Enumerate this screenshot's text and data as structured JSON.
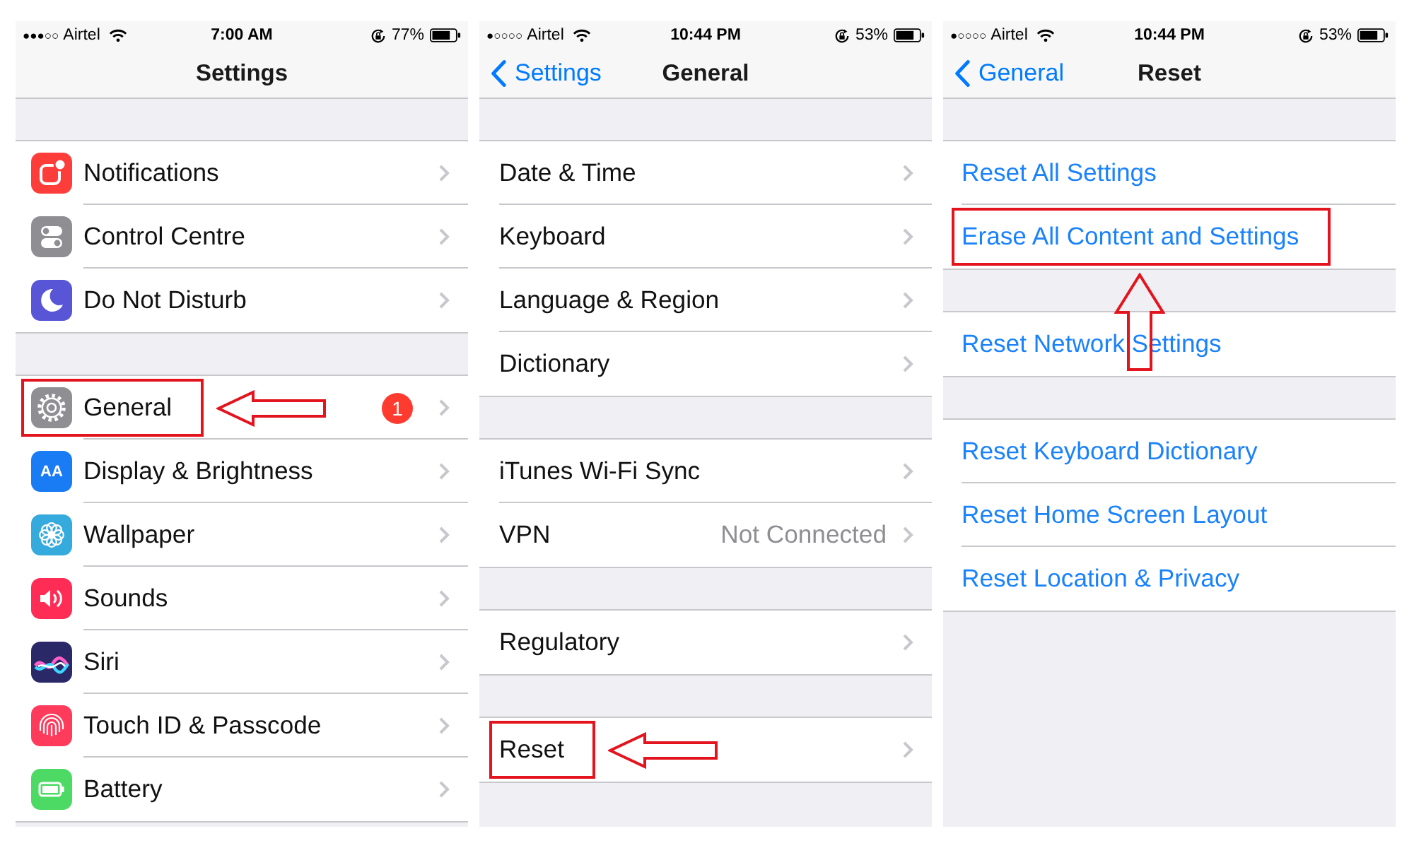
{
  "screens": [
    {
      "status_bar": {
        "signal": "●●●○○",
        "carrier": "Airtel",
        "time": "7:00 AM",
        "battery": "77%"
      },
      "nav_bar": {
        "title": "Settings"
      },
      "groups": [
        {
          "rows": [
            {
              "kind": "disclosure",
              "label": "Notifications",
              "color": "#fc3d39",
              "highlighted": false
            },
            {
              "kind": "disclosure",
              "label": "Control Centre",
              "color": "#8e8e93",
              "highlighted": false
            },
            {
              "kind": "disclosure",
              "label": "Do Not Disturb",
              "color": "#5856d6",
              "highlighted": false
            }
          ]
        },
        {
          "rows": [
            {
              "kind": "disclosure",
              "label": "General",
              "color": "#8e8e93",
              "badge": "1",
              "highlighted": true,
              "arrow": {
                "kind": "left"
              }
            },
            {
              "kind": "disclosure",
              "label": "Display & Brightness",
              "color": "#1a7cf5",
              "icon_text": "AA",
              "highlighted": false
            },
            {
              "kind": "disclosure",
              "label": "Wallpaper",
              "color": "#35aadc",
              "highlighted": false
            },
            {
              "kind": "disclosure",
              "label": "Sounds",
              "color": "#ff2d55",
              "highlighted": false
            },
            {
              "kind": "disclosure",
              "label": "Siri",
              "color": "#2a2866",
              "highlighted": false
            },
            {
              "kind": "disclosure",
              "label": "Touch ID & Passcode",
              "color": "#ff3b5c",
              "highlighted": false
            },
            {
              "kind": "disclosure",
              "label": "Battery",
              "color": "#4cd964",
              "highlighted": false
            }
          ]
        }
      ]
    },
    {
      "status_bar": {
        "signal": "●○○○○",
        "carrier": "Airtel",
        "time": "10:44 PM",
        "battery": "53%"
      },
      "nav_bar": {
        "back": "Settings",
        "title": "General"
      },
      "groups": [
        {
          "rows": [
            {
              "kind": "disclosure",
              "label": "Date & Time",
              "highlighted": false
            },
            {
              "kind": "disclosure",
              "label": "Keyboard",
              "highlighted": false
            },
            {
              "kind": "disclosure",
              "label": "Language & Region",
              "highlighted": false
            },
            {
              "kind": "disclosure",
              "label": "Dictionary",
              "highlighted": false
            }
          ]
        },
        {
          "rows": [
            {
              "kind": "disclosure",
              "label": "iTunes Wi-Fi Sync",
              "highlighted": false
            },
            {
              "kind": "disclosure",
              "label": "VPN",
              "value": "Not Connected",
              "highlighted": false
            }
          ]
        },
        {
          "rows": [
            {
              "kind": "disclosure",
              "label": "Regulatory",
              "highlighted": false
            }
          ]
        },
        {
          "rows": [
            {
              "kind": "disclosure",
              "label": "Reset",
              "highlighted": true,
              "arrow": {
                "kind": "left"
              }
            }
          ]
        }
      ]
    },
    {
      "status_bar": {
        "signal": "●○○○○",
        "carrier": "Airtel",
        "time": "10:44 PM",
        "battery": "53%"
      },
      "nav_bar": {
        "back": "General",
        "title": "Reset"
      },
      "groups": [
        {
          "rows": [
            {
              "kind": "action",
              "label": "Reset All Settings",
              "highlighted": false
            },
            {
              "kind": "action",
              "label": "Erase All Content and Settings",
              "highlighted": true,
              "arrow": {
                "kind": "up"
              }
            }
          ]
        },
        {
          "rows": [
            {
              "kind": "action",
              "label": "Reset Network Settings",
              "highlighted": false
            }
          ]
        },
        {
          "rows": [
            {
              "kind": "action",
              "label": "Reset Keyboard Dictionary",
              "highlighted": false
            },
            {
              "kind": "action",
              "label": "Reset Home Screen Layout",
              "highlighted": false
            },
            {
              "kind": "action",
              "label": "Reset Location & Privacy",
              "highlighted": false
            }
          ]
        }
      ]
    }
  ]
}
